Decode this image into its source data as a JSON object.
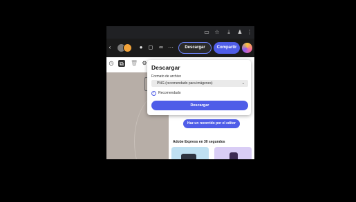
{
  "browser": {
    "icons": [
      "screen-share-icon",
      "star-icon",
      "download-icon",
      "extension-icon",
      "more-vert-icon"
    ]
  },
  "toolbar": {
    "download_label": "Descargar",
    "share_label": "Compartir",
    "more_label": "···",
    "accent": "#4f5de8"
  },
  "download_popup": {
    "title": "Descargar",
    "format_label": "Formato de archivo",
    "format_value": "PNG (recomendado para imágenes)",
    "recommended_label": "Recomendado",
    "download_button": "Descargar"
  },
  "side_panel": {
    "tour_button": "Haz un recorrido por el editor",
    "section_title": "Adobe Express en 30 segundos"
  }
}
